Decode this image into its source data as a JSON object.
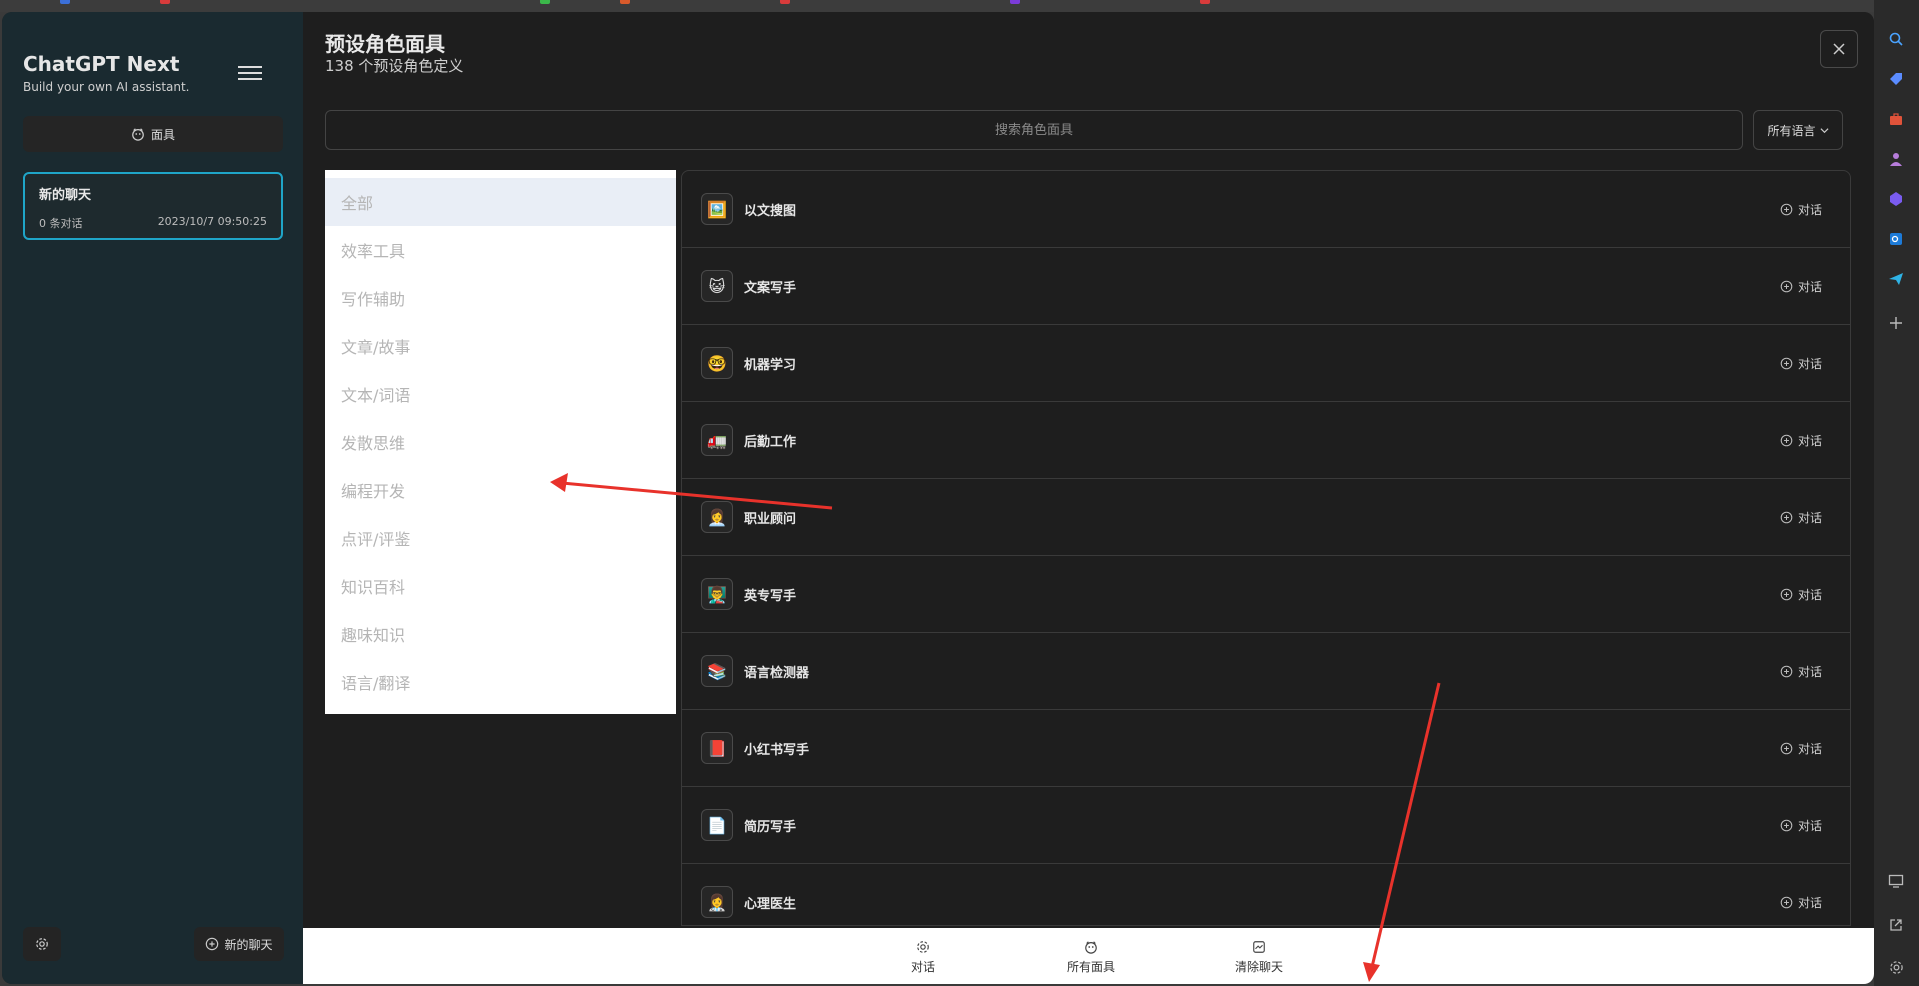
{
  "sidebar": {
    "title": "ChatGPT Next",
    "subtitle": "Build your own AI assistant.",
    "mask_button": "面具",
    "chat": {
      "title": "新的聊天",
      "count": "0 条对话",
      "time": "2023/10/7 09:50:25"
    },
    "new_chat_label": "新的聊天"
  },
  "main": {
    "title": "预设角色面具",
    "subtitle": "138 个预设角色定义",
    "search_placeholder": "搜索角色面具",
    "language_label": "所有语言",
    "categories": [
      {
        "label": "全部"
      },
      {
        "label": "效率工具"
      },
      {
        "label": "写作辅助"
      },
      {
        "label": "文章/故事"
      },
      {
        "label": "文本/词语"
      },
      {
        "label": "发散思维"
      },
      {
        "label": "编程开发"
      },
      {
        "label": "点评/评鉴"
      },
      {
        "label": "知识百科"
      },
      {
        "label": "趣味知识"
      },
      {
        "label": "语言/翻译"
      }
    ],
    "masks": [
      {
        "name": "以文搜图",
        "icon": "🖼️",
        "action": "对话"
      },
      {
        "name": "文案写手",
        "icon": "😺",
        "action": "对话"
      },
      {
        "name": "机器学习",
        "icon": "🤓",
        "action": "对话"
      },
      {
        "name": "后勤工作",
        "icon": "🚛",
        "action": "对话"
      },
      {
        "name": "职业顾问",
        "icon": "👩‍💼",
        "action": "对话"
      },
      {
        "name": "英专写手",
        "icon": "👨‍🏫",
        "action": "对话"
      },
      {
        "name": "语言检测器",
        "icon": "📚",
        "action": "对话"
      },
      {
        "name": "小红书写手",
        "icon": "📕",
        "action": "对话"
      },
      {
        "name": "简历写手",
        "icon": "📄",
        "action": "对话"
      },
      {
        "name": "心理医生",
        "icon": "👩‍⚕️",
        "action": "对话"
      }
    ]
  },
  "bottom_bar": {
    "chat": "对话",
    "all_masks": "所有面具",
    "clear_chat": "清除聊天"
  },
  "colors": {
    "accent": "#1fa5c8",
    "annotation": "#e8322b",
    "sidebar_bg": "#1a2a30",
    "panel_bg": "#1e1e1e"
  }
}
